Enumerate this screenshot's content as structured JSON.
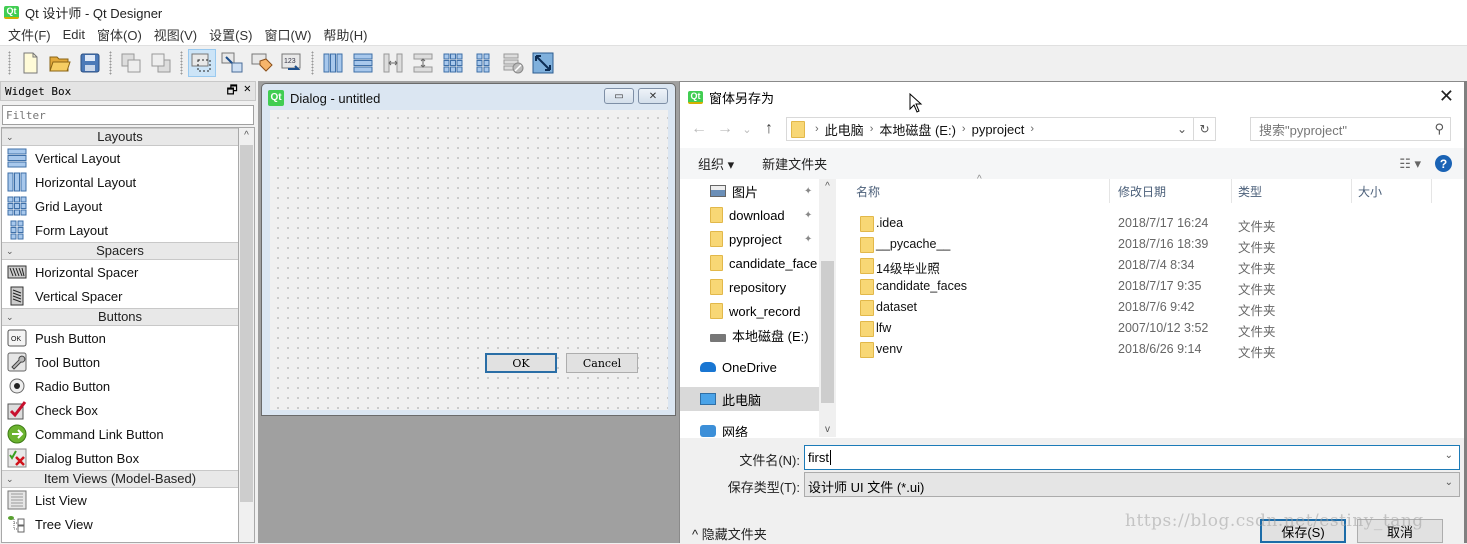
{
  "app": {
    "title": "Qt 设计师 - Qt Designer",
    "logo_text": "Qt"
  },
  "menu": [
    "文件(F)",
    "Edit",
    "窗体(O)",
    "视图(V)",
    "设置(S)",
    "窗口(W)",
    "帮助(H)"
  ],
  "toolbar": {
    "groups": [
      [
        "new-file-icon",
        "open-folder-icon",
        "save-icon"
      ],
      [
        "send-to-back-icon",
        "bring-to-front-icon"
      ],
      [
        "edit-widgets-icon",
        "edit-signals-slots-icon",
        "edit-buddies-icon",
        "edit-tab-order-icon"
      ],
      [
        "layout-horizontal-icon",
        "layout-vertical-icon",
        "layout-horizontal-splitter-icon",
        "layout-vertical-splitter-icon",
        "layout-grid-icon",
        "layout-form-icon",
        "break-layout-icon",
        "adjust-size-icon"
      ]
    ],
    "active": "edit-widgets-icon"
  },
  "widget_box": {
    "title": "Widget Box",
    "filter_placeholder": "Filter",
    "float_glyph": "🗗",
    "close_glyph": "✕",
    "categories": [
      {
        "label": "Layouts",
        "items": [
          {
            "label": "Vertical Layout",
            "icon": "vertical-layout-icon"
          },
          {
            "label": "Horizontal Layout",
            "icon": "horizontal-layout-icon"
          },
          {
            "label": "Grid Layout",
            "icon": "grid-layout-icon"
          },
          {
            "label": "Form Layout",
            "icon": "form-layout-icon"
          }
        ]
      },
      {
        "label": "Spacers",
        "items": [
          {
            "label": "Horizontal Spacer",
            "icon": "horizontal-spacer-icon"
          },
          {
            "label": "Vertical Spacer",
            "icon": "vertical-spacer-icon"
          }
        ]
      },
      {
        "label": "Buttons",
        "items": [
          {
            "label": "Push Button",
            "icon": "push-button-icon"
          },
          {
            "label": "Tool Button",
            "icon": "tool-button-icon"
          },
          {
            "label": "Radio Button",
            "icon": "radio-button-icon"
          },
          {
            "label": "Check Box",
            "icon": "check-box-icon"
          },
          {
            "label": "Command Link Button",
            "icon": "command-link-icon"
          },
          {
            "label": "Dialog Button Box",
            "icon": "dialog-button-box-icon"
          }
        ]
      },
      {
        "label": "Item Views (Model-Based)",
        "items": [
          {
            "label": "List View",
            "icon": "list-view-icon"
          },
          {
            "label": "Tree View",
            "icon": "tree-view-icon"
          }
        ]
      }
    ]
  },
  "form_window": {
    "title": "Dialog - untitled",
    "minimize_glyph": "▭",
    "close_glyph": "✕",
    "ok_label": "OK",
    "cancel_label": "Cancel"
  },
  "save_dialog": {
    "title": "窗体另存为",
    "close_glyph": "✕",
    "nav": {
      "back": "←",
      "forward": "→",
      "recent": "⌄",
      "up": "↑"
    },
    "breadcrumb": [
      "此电脑",
      "本地磁盘 (E:)",
      "pyproject"
    ],
    "refresh_glyph": "↻",
    "dropdown_glyph": "⌄",
    "search_placeholder": "搜索\"pyproject\"",
    "search_glyph": "⚲",
    "commands": {
      "organize": "组织 ▾",
      "new_folder": "新建文件夹",
      "view_glyph": "☷ ▾",
      "help": "?"
    },
    "nav_pane": [
      {
        "label": "图片",
        "icon": "pictures-icon",
        "pinned": true
      },
      {
        "label": "download",
        "icon": "folder-icon",
        "pinned": true
      },
      {
        "label": "pyproject",
        "icon": "folder-icon",
        "pinned": true
      },
      {
        "label": "candidate_face",
        "icon": "folder-icon",
        "pinned": false
      },
      {
        "label": "repository",
        "icon": "folder-icon",
        "pinned": false
      },
      {
        "label": "work_record",
        "icon": "folder-icon",
        "pinned": false
      },
      {
        "label": "本地磁盘 (E:)",
        "icon": "drive-icon",
        "pinned": false
      },
      {
        "label": "OneDrive",
        "icon": "onedrive-icon",
        "pinned": false
      },
      {
        "label": "此电脑",
        "icon": "this-pc-icon",
        "pinned": false,
        "selected": true
      },
      {
        "label": "网络",
        "icon": "network-icon",
        "pinned": false
      }
    ],
    "pin_glyph": "📌",
    "columns": [
      "名称",
      "修改日期",
      "类型",
      "大小"
    ],
    "sort_glyph": "^",
    "files": [
      {
        "name": ".idea",
        "date": "2018/7/17 16:24",
        "type": "文件夹"
      },
      {
        "name": "__pycache__",
        "date": "2018/7/16 18:39",
        "type": "文件夹"
      },
      {
        "name": "14级毕业照",
        "date": "2018/7/4 8:34",
        "type": "文件夹"
      },
      {
        "name": "candidate_faces",
        "date": "2018/7/17 9:35",
        "type": "文件夹"
      },
      {
        "name": "dataset",
        "date": "2018/7/6 9:42",
        "type": "文件夹"
      },
      {
        "name": "lfw",
        "date": "2007/10/12 3:52",
        "type": "文件夹"
      },
      {
        "name": "venv",
        "date": "2018/6/26 9:14",
        "type": "文件夹"
      }
    ],
    "filename_label": "文件名(N):",
    "filename_value": "first",
    "filetype_label": "保存类型(T):",
    "filetype_value": "设计师 UI 文件 (*.ui)",
    "hide_folders": "^  隐藏文件夹",
    "save_label": "保存(S)",
    "cancel_label": "取消"
  },
  "watermark": "https://blog.csdn.net/estiny_tang"
}
